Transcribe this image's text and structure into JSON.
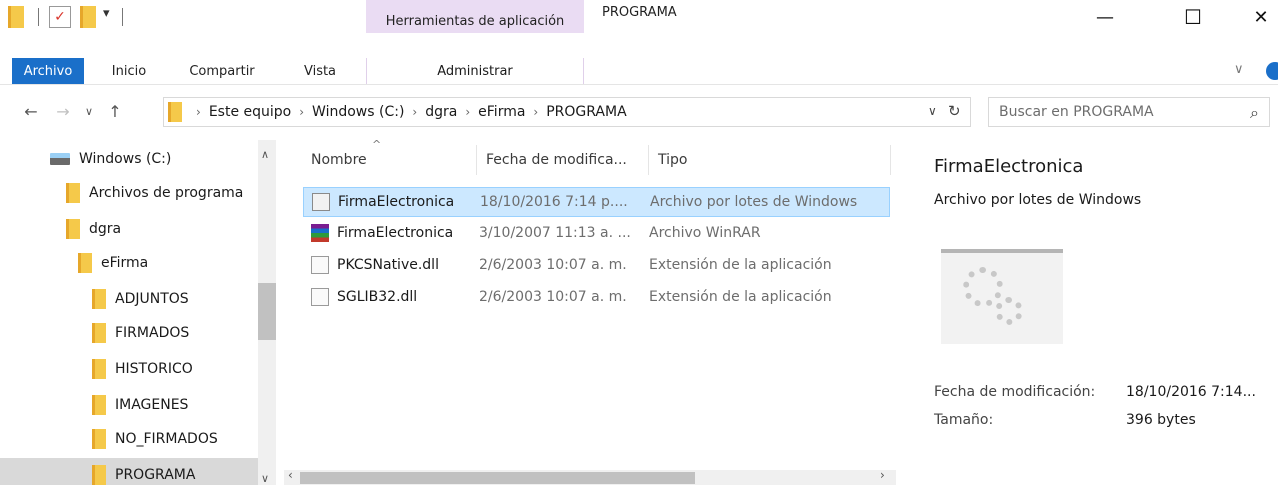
{
  "window": {
    "title": "PROGRAMA",
    "tools_tab": "Herramientas de aplicación",
    "minimize": "—",
    "maximize": "☐",
    "close": "✕"
  },
  "ribbon": {
    "tabs": [
      "Archivo",
      "Inicio",
      "Compartir",
      "Vista"
    ],
    "tools_sub": "Administrar"
  },
  "address": {
    "crumbs": [
      "Este equipo",
      "Windows (C:)",
      "dgra",
      "eFirma",
      "PROGRAMA"
    ],
    "search_placeholder": "Buscar en PROGRAMA"
  },
  "nav": {
    "items": [
      {
        "label": "Windows (C:)",
        "type": "drive"
      },
      {
        "label": "Archivos de programa",
        "type": "folder"
      },
      {
        "label": "dgra",
        "type": "folder"
      },
      {
        "label": "eFirma",
        "type": "folder"
      },
      {
        "label": "ADJUNTOS",
        "type": "folder"
      },
      {
        "label": "FIRMADOS",
        "type": "folder"
      },
      {
        "label": "HISTORICO",
        "type": "folder"
      },
      {
        "label": "IMAGENES",
        "type": "folder"
      },
      {
        "label": "NO_FIRMADOS",
        "type": "folder"
      },
      {
        "label": "PROGRAMA",
        "type": "folder",
        "selected": true
      }
    ]
  },
  "files": {
    "columns": [
      "Nombre",
      "Fecha de modifica...",
      "Tipo"
    ],
    "rows": [
      {
        "name": "FirmaElectronica",
        "date": "18/10/2016 7:14 p....",
        "type": "Archivo por lotes de Windows",
        "icon": "batch-file-icon",
        "selected": true
      },
      {
        "name": "FirmaElectronica",
        "date": "3/10/2007 11:13 a. ...",
        "type": "Archivo WinRAR",
        "icon": "winrar-icon"
      },
      {
        "name": "PKCSNative.dll",
        "date": "2/6/2003 10:07 a. m.",
        "type": "Extensión de la aplicación",
        "icon": "dll-file-icon"
      },
      {
        "name": "SGLIB32.dll",
        "date": "2/6/2003 10:07 a. m.",
        "type": "Extensión de la aplicación",
        "icon": "dll-file-icon"
      }
    ]
  },
  "details": {
    "title": "FirmaElectronica",
    "subtitle": "Archivo por lotes de Windows",
    "modified_label": "Fecha de modificación:",
    "modified_value": "18/10/2016 7:14...",
    "size_label": "Tamaño:",
    "size_value": "396 bytes"
  },
  "colors": {
    "accent": "#1a6fc9",
    "tools_tab": "#eadcf3",
    "selection": "#cce8ff"
  }
}
